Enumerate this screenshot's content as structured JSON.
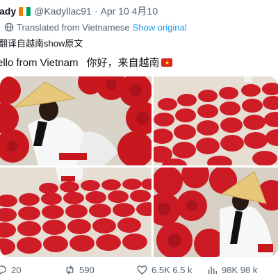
{
  "header": {
    "display_name": "ady",
    "handle": "@Kadyllac91",
    "separator": "·",
    "date": "Apr 10 4月10",
    "flag_colors": [
      "#f77f00",
      "#ffffff",
      "#009e60"
    ]
  },
  "translation": {
    "label": "Translated from Vietnamese",
    "show_original": "Show original",
    "original_text": "翻译自越南show原文"
  },
  "tweet": {
    "text_en": "ello from Vietnam",
    "text_zh": "你好，来自越南"
  },
  "media": {
    "photos": [
      {
        "name": "photo-1",
        "icon": "photo"
      },
      {
        "name": "photo-2",
        "icon": "photo"
      },
      {
        "name": "photo-3",
        "icon": "photo"
      },
      {
        "name": "photo-4",
        "icon": "photo"
      }
    ],
    "colors": {
      "incense": "#d91f2a",
      "incense_dark": "#8e0f18",
      "dress": "#f7f7f7",
      "hat": "#e7c77a"
    }
  },
  "actions": {
    "replies": "20",
    "retweets": "590",
    "likes": "6.5K 6.5 k",
    "views": "98K 98 k"
  },
  "colors": {
    "accent": "#1d9bf0",
    "secondary_text": "#536471"
  }
}
